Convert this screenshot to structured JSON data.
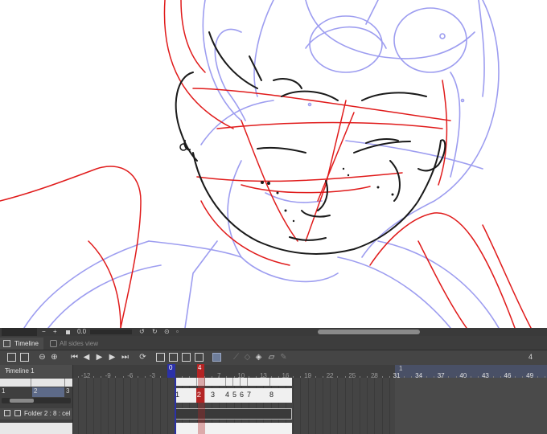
{
  "canvas": {
    "description_icon": "sketch-canvas"
  },
  "statusbar": {
    "zoom_value": "0.0",
    "zoom_out": "−",
    "zoom_in": "+"
  },
  "tabs": {
    "timeline_label": "Timeline",
    "allsides_label": "All sides view"
  },
  "toolbar": {
    "fps_value": "4"
  },
  "timeline": {
    "name": "Timeline 1",
    "start_marker": "0",
    "current_marker": "4",
    "end_label": "1",
    "ruler_numbers": [
      "-12",
      "-9",
      "-6",
      "-3",
      "0",
      "4",
      "7",
      "10",
      "13",
      "16",
      "19",
      "22",
      "25",
      "28",
      "31",
      "34",
      "37",
      "40",
      "43",
      "46",
      "49"
    ],
    "mini_numbers": [
      "1",
      "2",
      "3"
    ],
    "folder_label": "Folder 2 : 8 : cel",
    "cel_numbers": [
      "1",
      "2",
      "3",
      "4",
      "5",
      "6",
      "7",
      "8"
    ],
    "current_cel": "2"
  },
  "colors": {
    "panel_bg": "#474747",
    "current_frame": "#b42424",
    "start_marker": "#2b31a8",
    "sketch_red": "#e01b1b",
    "sketch_blue": "#9d9df0",
    "ink": "#1a1a1a"
  }
}
